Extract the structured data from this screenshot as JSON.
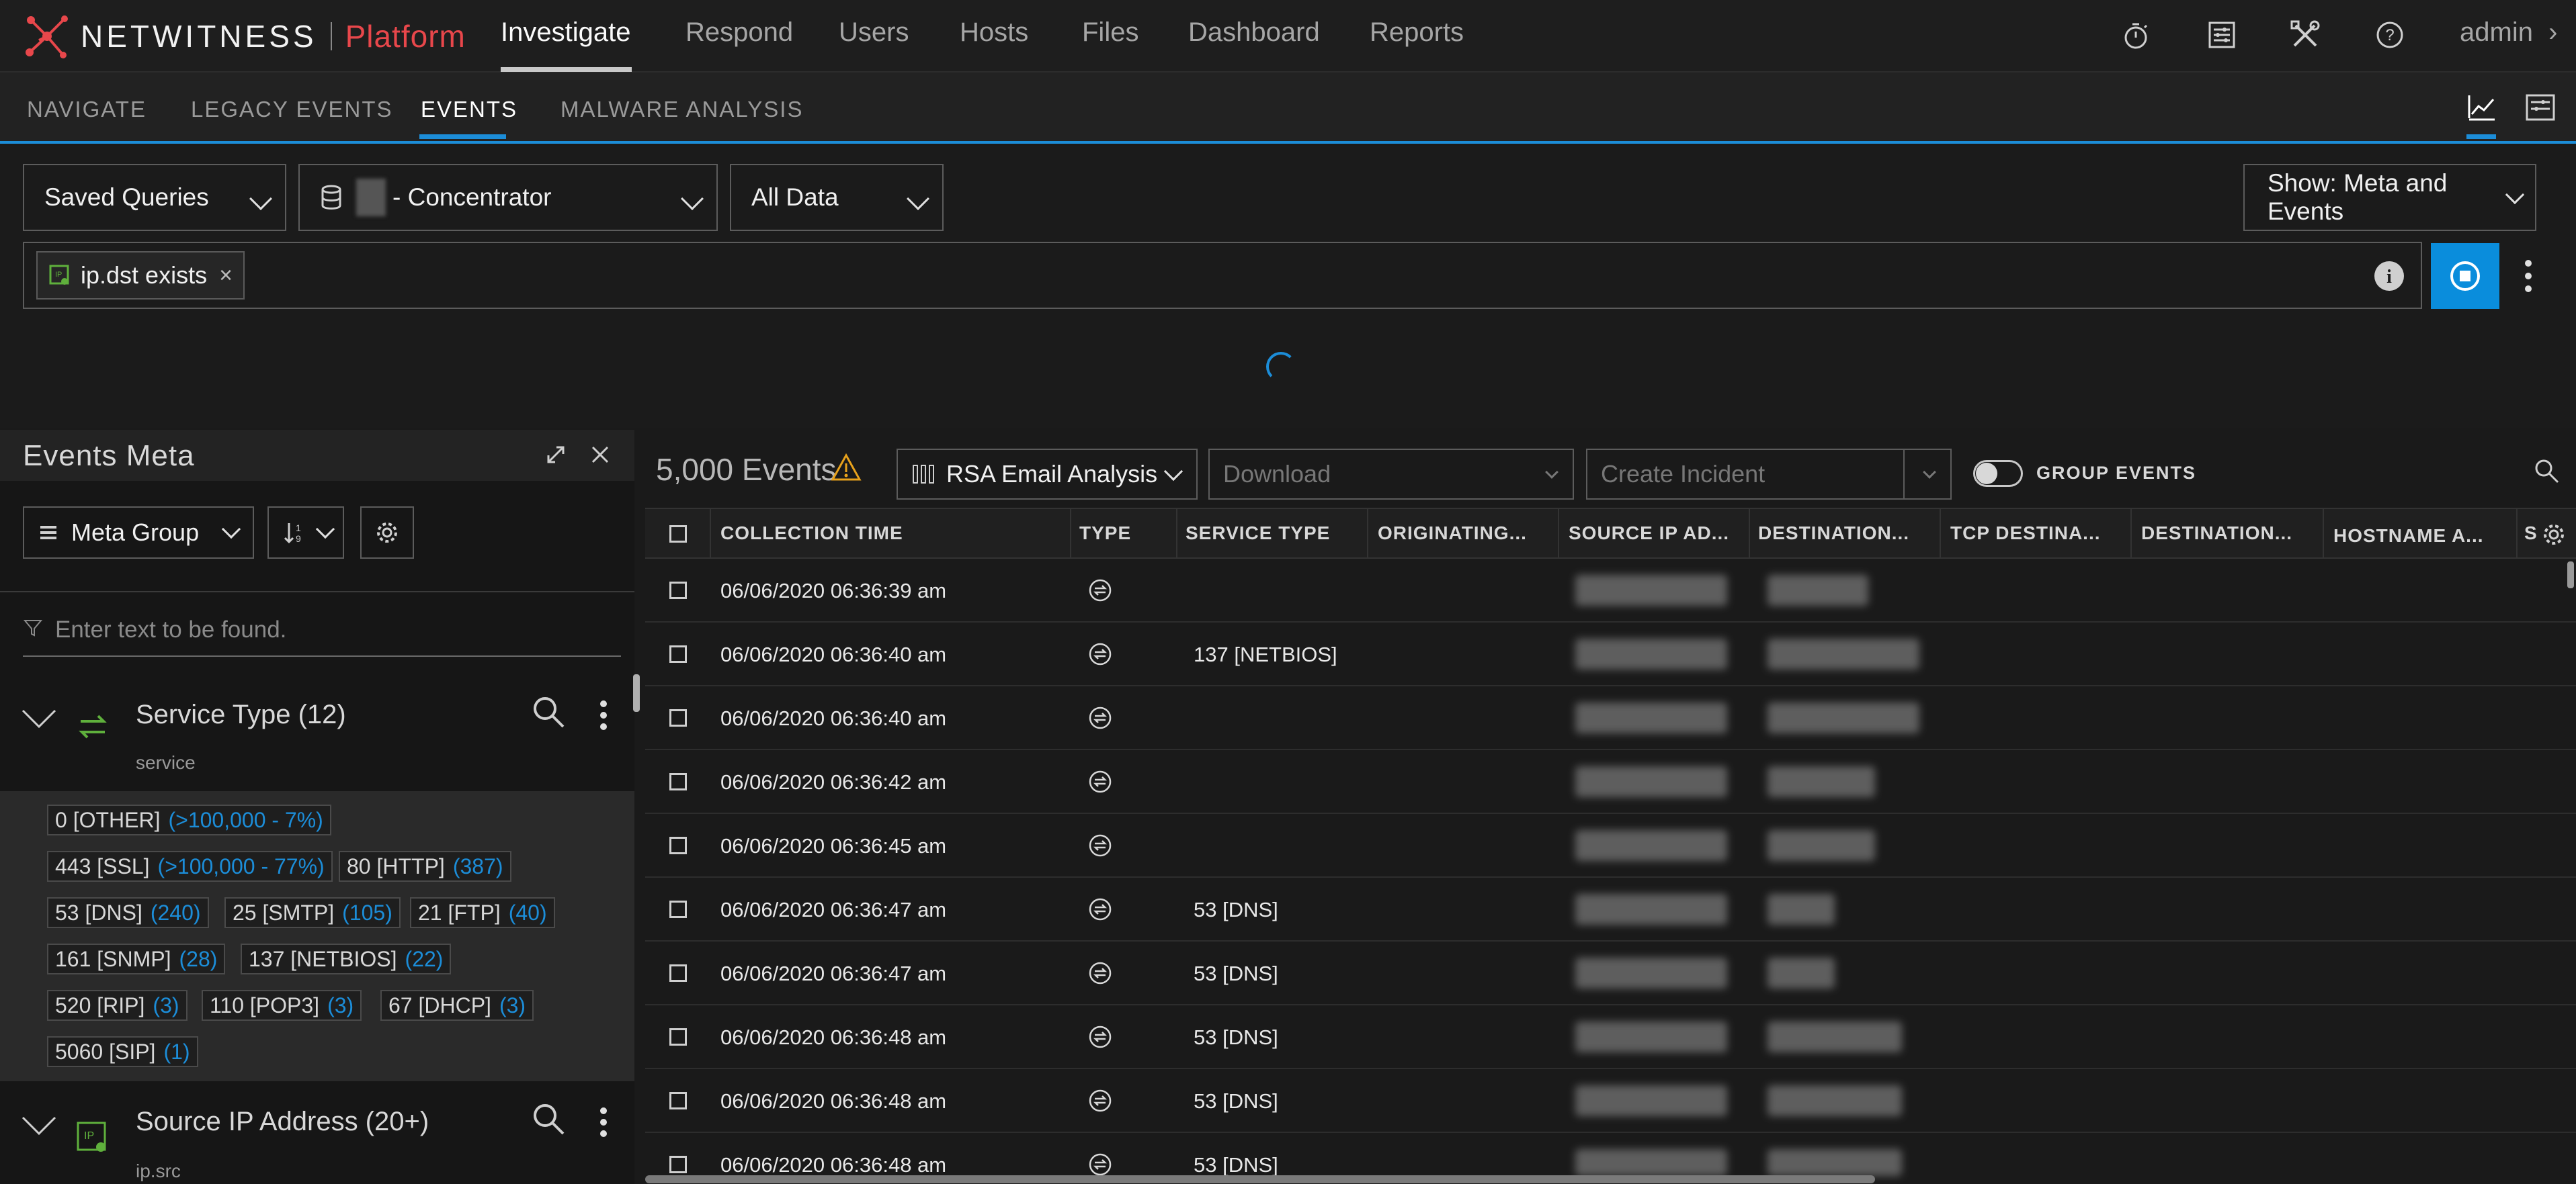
{
  "brand": {
    "name": "NETWITNESS",
    "product": "Platform"
  },
  "topnav": {
    "items": [
      "Investigate",
      "Respond",
      "Users",
      "Hosts",
      "Files",
      "Dashboard",
      "Reports"
    ],
    "user": "admin"
  },
  "subnav": {
    "items": [
      "NAVIGATE",
      "LEGACY EVENTS",
      "EVENTS",
      "MALWARE ANALYSIS"
    ]
  },
  "query": {
    "saved_queries": "Saved Queries",
    "service": "- Concentrator",
    "time_range": "All Data",
    "show": "Show: Meta and Events",
    "pill": "ip.dst exists"
  },
  "meta_panel": {
    "title": "Events Meta",
    "group_button": "Meta Group",
    "filter_placeholder": "Enter text to be found.",
    "groups": [
      {
        "title": "Service Type (12)",
        "key": "service"
      },
      {
        "title": "Source IP Address (20+)",
        "key": "ip.src"
      }
    ],
    "service_values": [
      {
        "label": "0 [OTHER]",
        "count": "(>100,000 - 7%)"
      },
      {
        "label": "443 [SSL]",
        "count": "(>100,000 - 77%)"
      },
      {
        "label": "80 [HTTP]",
        "count": "(387)"
      },
      {
        "label": "53 [DNS]",
        "count": "(240)"
      },
      {
        "label": "25 [SMTP]",
        "count": "(105)"
      },
      {
        "label": "21 [FTP]",
        "count": "(40)"
      },
      {
        "label": "161 [SNMP]",
        "count": "(28)"
      },
      {
        "label": "137 [NETBIOS]",
        "count": "(22)"
      },
      {
        "label": "520 [RIP]",
        "count": "(3)"
      },
      {
        "label": "110 [POP3]",
        "count": "(3)"
      },
      {
        "label": "67 [DHCP]",
        "count": "(3)"
      },
      {
        "label": "5060 [SIP]",
        "count": "(1)"
      }
    ]
  },
  "events": {
    "count": "5,000 Events",
    "profile": "RSA Email Analysis",
    "download": "Download",
    "create_incident": "Create Incident",
    "group_events": "GROUP EVENTS",
    "columns": [
      "COLLECTION TIME",
      "TYPE",
      "SERVICE TYPE",
      "ORIGINATING...",
      "SOURCE IP AD...",
      "DESTINATION...",
      "TCP DESTINA...",
      "DESTINATION...",
      "HOSTNAME A..."
    ],
    "rows": [
      {
        "time": "06/06/2020 06:36:39 am",
        "service": ""
      },
      {
        "time": "06/06/2020 06:36:40 am",
        "service": "137 [NETBIOS]"
      },
      {
        "time": "06/06/2020 06:36:40 am",
        "service": ""
      },
      {
        "time": "06/06/2020 06:36:42 am",
        "service": ""
      },
      {
        "time": "06/06/2020 06:36:45 am",
        "service": ""
      },
      {
        "time": "06/06/2020 06:36:47 am",
        "service": "53 [DNS]"
      },
      {
        "time": "06/06/2020 06:36:47 am",
        "service": "53 [DNS]"
      },
      {
        "time": "06/06/2020 06:36:48 am",
        "service": "53 [DNS]"
      },
      {
        "time": "06/06/2020 06:36:48 am",
        "service": "53 [DNS]"
      },
      {
        "time": "06/06/2020 06:36:48 am",
        "service": "53 [DNS]"
      }
    ]
  },
  "colors": {
    "accent": "#1c8dd8",
    "brand_red": "#e8474b",
    "warning": "#e8a21c",
    "meta_icon": "#5fb03c"
  }
}
